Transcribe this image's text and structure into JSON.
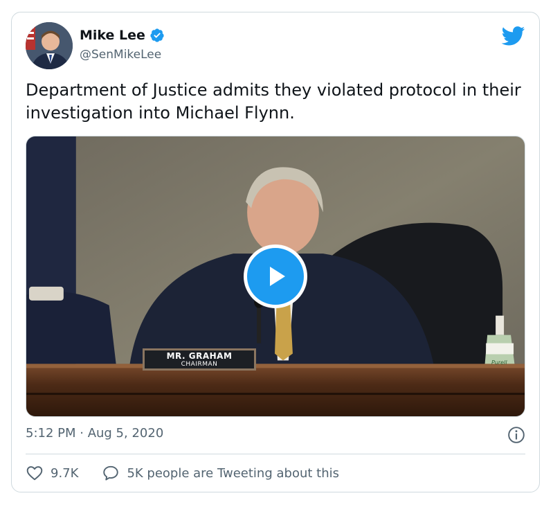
{
  "author": {
    "name": "Mike Lee",
    "handle": "@SenMikeLee",
    "verified": true
  },
  "tweet": {
    "text": "Department of Justice admits they violated protocol in their investigation into Michael Flynn."
  },
  "media": {
    "type": "video",
    "nameplate_name": "MR. GRAHAM",
    "nameplate_title": "CHAIRMAN",
    "bottle_label": "Purell"
  },
  "meta": {
    "timestamp": "5:12 PM · Aug 5, 2020"
  },
  "actions": {
    "like_count": "9.7K",
    "reply_text": "5K people are Tweeting about this"
  },
  "icons": {
    "verified": "verified-badge-icon",
    "brand": "twitter-bird-icon",
    "play": "play-icon",
    "info": "info-icon",
    "like": "heart-icon",
    "reply": "speech-bubble-icon"
  },
  "colors": {
    "accent": "#1d9bf0",
    "text_primary": "#0f1419",
    "text_secondary": "#536471",
    "border": "#cfd9de"
  }
}
